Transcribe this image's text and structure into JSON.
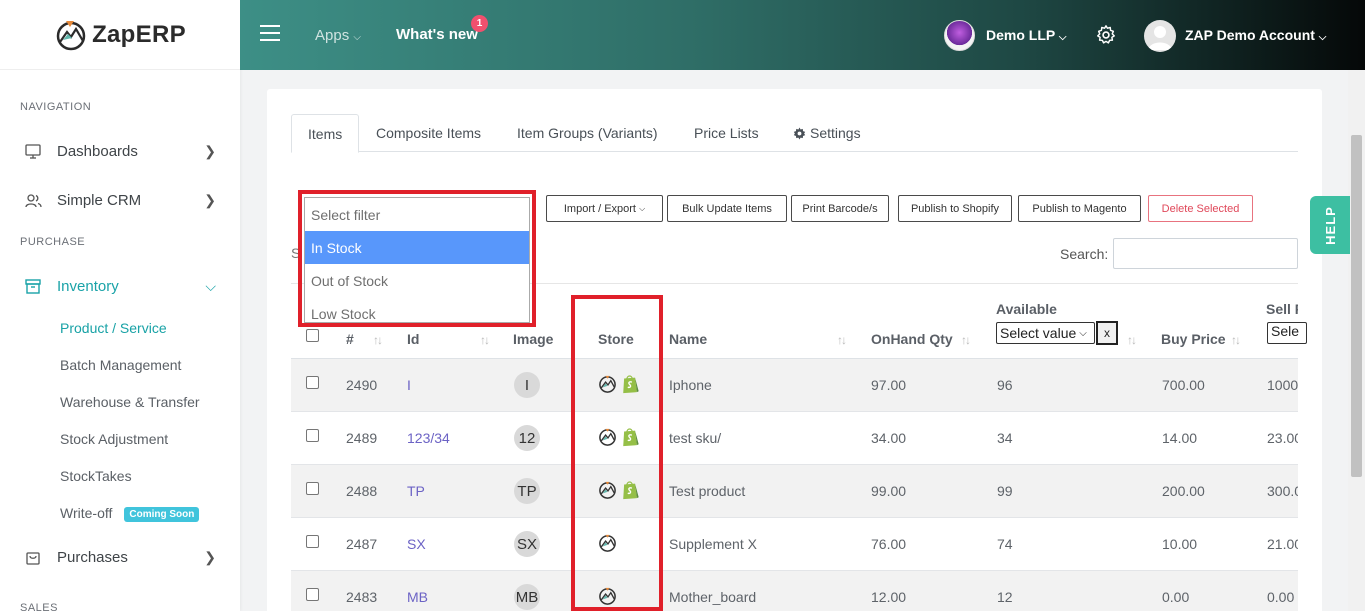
{
  "brand": {
    "name": "ZapERP"
  },
  "topbar": {
    "apps_label": "Apps",
    "whats_new_label": "What's new",
    "notification_count": "1",
    "org_name": "Demo LLP",
    "user_name": "ZAP Demo Account"
  },
  "sidebar": {
    "heading_navigation": "NAVIGATION",
    "dashboards": "Dashboards",
    "simple_crm": "Simple CRM",
    "heading_purchase": "PURCHASE",
    "inventory": "Inventory",
    "sub_items": [
      "Product / Service",
      "Batch Management",
      "Warehouse & Transfer",
      "Stock Adjustment",
      "StockTakes",
      "Write-off"
    ],
    "coming_soon": "Coming Soon",
    "purchases": "Purchases",
    "heading_sales": "SALES"
  },
  "tabs": [
    "Items",
    "Composite Items",
    "Item Groups (Variants)",
    "Price Lists",
    "Settings"
  ],
  "toolbar": {
    "import_export": "Import / Export",
    "bulk_update": "Bulk Update Items",
    "print_barcode": "Print Barcode/s",
    "publish_shopify": "Publish to Shopify",
    "publish_magento": "Publish to Magento",
    "delete_selected": "Delete Selected"
  },
  "filter": {
    "placeholder": "Select filter",
    "options": [
      "In Stock",
      "Out of Stock",
      "Low Stock"
    ],
    "selected": "In Stock"
  },
  "show_prefix": "S",
  "search_label": "Search:",
  "help_label": "HELP",
  "table": {
    "headers": {
      "num": "#",
      "id": "Id",
      "image": "Image",
      "store": "Store",
      "name": "Name",
      "onhand": "OnHand Qty",
      "available": "Available",
      "available_select": "Select value",
      "clear": "x",
      "buy_price": "Buy Price",
      "sell_price": "Sell P",
      "sell_select": "Sele"
    },
    "rows": [
      {
        "num": "2490",
        "id": "I",
        "initial": "I",
        "stores": [
          "zap",
          "shopify"
        ],
        "name": "Iphone",
        "onhand": "97.00",
        "available": "96",
        "buy": "700.00",
        "sell": "1000"
      },
      {
        "num": "2489",
        "id": "123/34",
        "initial": "12",
        "stores": [
          "zap",
          "shopify"
        ],
        "name": "test sku/",
        "onhand": "34.00",
        "available": "34",
        "buy": "14.00",
        "sell": "23.00"
      },
      {
        "num": "2488",
        "id": "TP",
        "initial": "TP",
        "stores": [
          "zap",
          "shopify"
        ],
        "name": "Test product",
        "onhand": "99.00",
        "available": "99",
        "buy": "200.00",
        "sell": "300.0"
      },
      {
        "num": "2487",
        "id": "SX",
        "initial": "SX",
        "stores": [
          "zap"
        ],
        "name": "Supplement X",
        "onhand": "76.00",
        "available": "74",
        "buy": "10.00",
        "sell": "21.00"
      },
      {
        "num": "2483",
        "id": "MB",
        "initial": "MB",
        "stores": [
          "zap"
        ],
        "name": "Mother_board",
        "onhand": "12.00",
        "available": "12",
        "buy": "0.00",
        "sell": "0.00"
      }
    ]
  },
  "colors": {
    "accent": "#1aa3a8",
    "highlight_box": "#e0202a",
    "help": "#3dbfa2",
    "link": "#6c63c5"
  }
}
